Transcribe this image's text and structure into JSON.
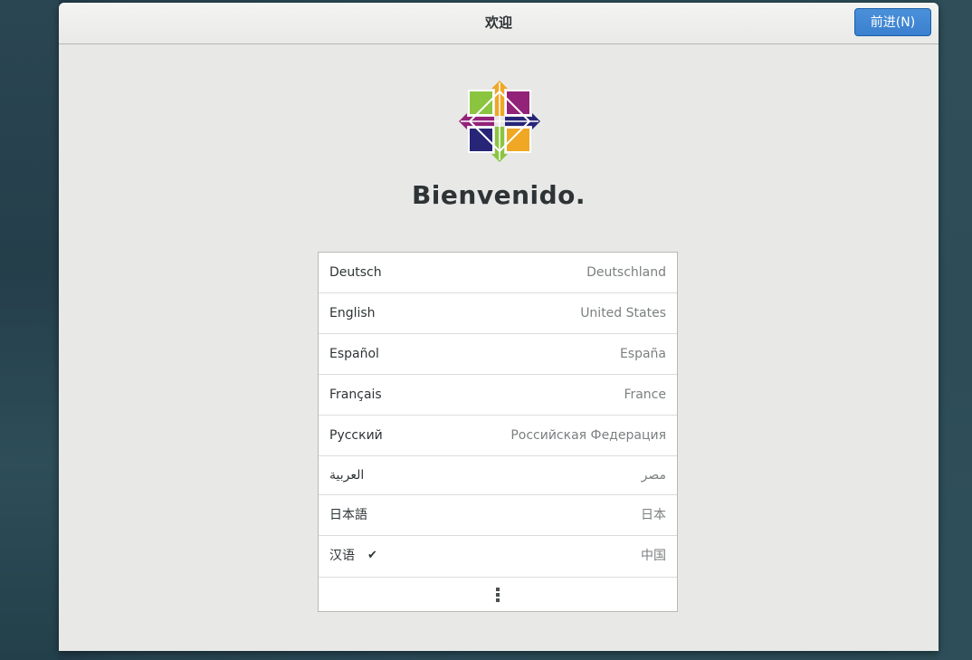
{
  "window": {
    "title": "欢迎",
    "next_button": "前进(N)"
  },
  "welcome_text": "Bienvenido.",
  "logo_icon": "centos-logo-icon",
  "languages": [
    {
      "name": "Deutsch",
      "region": "Deutschland",
      "selected": false
    },
    {
      "name": "English",
      "region": "United States",
      "selected": false
    },
    {
      "name": "Español",
      "region": "España",
      "selected": false
    },
    {
      "name": "Français",
      "region": "France",
      "selected": false
    },
    {
      "name": "Русский",
      "region": "Российская Федерация",
      "selected": false
    },
    {
      "name": "العربية",
      "region": "مصر",
      "selected": false
    },
    {
      "name": "日本語",
      "region": "日本",
      "selected": false
    },
    {
      "name": "汉语",
      "region": "中国",
      "selected": true
    }
  ],
  "more_icon": "more-vertical-icon",
  "check_icon": "checkmark-icon",
  "colors": {
    "accent": "#3a80cf",
    "logo_green": "#8bc53f",
    "logo_purple": "#932279",
    "logo_orange": "#efa724",
    "logo_navy": "#262577"
  }
}
